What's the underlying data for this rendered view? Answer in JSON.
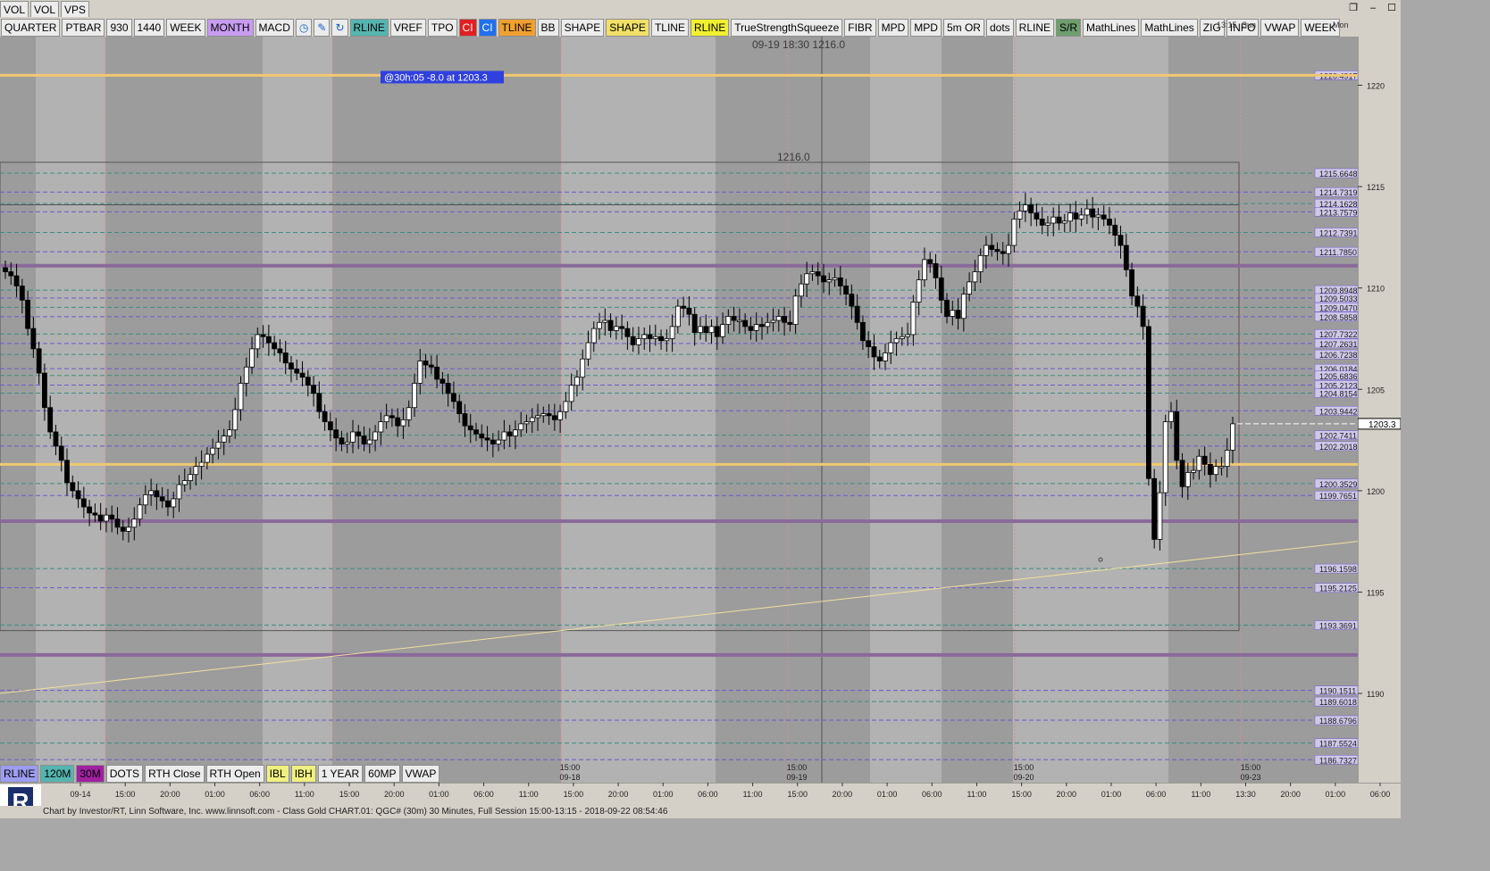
{
  "toolbar_top": {
    "items": [
      {
        "label": "VOL",
        "bg": "#ececec"
      },
      {
        "label": "VOL",
        "bg": "#ececec"
      },
      {
        "label": "VPS",
        "bg": "#ececec"
      }
    ]
  },
  "toolbar_main": {
    "items": [
      {
        "label": "QUARTER",
        "bg": "#ececec",
        "fg": "#000000"
      },
      {
        "label": "PTBAR",
        "bg": "#ececec",
        "fg": "#000000"
      },
      {
        "label": "930",
        "bg": "#ececec",
        "fg": "#000000"
      },
      {
        "label": "1440",
        "bg": "#ececec",
        "fg": "#000000"
      },
      {
        "label": "WEEK",
        "bg": "#ececec",
        "fg": "#000000"
      },
      {
        "label": "MONTH",
        "bg": "#c89cf0",
        "fg": "#000000"
      },
      {
        "label": "MACD",
        "bg": "#ececec",
        "fg": "#000000"
      },
      {
        "icon": "clock-icon",
        "bg": "#ececec"
      },
      {
        "icon": "pencil-icon",
        "bg": "#ececec"
      },
      {
        "icon": "refresh-icon",
        "bg": "#ececec"
      },
      {
        "label": "RLINE",
        "bg": "#56b4b0",
        "fg": "#000000"
      },
      {
        "label": "VREF",
        "bg": "#ececec",
        "fg": "#000000"
      },
      {
        "label": "TPO",
        "bg": "#ececec",
        "fg": "#000000"
      },
      {
        "label": "CI",
        "bg": "#e02020",
        "fg": "#ffffff"
      },
      {
        "label": "CI",
        "bg": "#2070f0",
        "fg": "#ffffff"
      },
      {
        "label": "TLINE",
        "bg": "#f0a030",
        "fg": "#000000"
      },
      {
        "label": "BB",
        "bg": "#ececec",
        "fg": "#000000"
      },
      {
        "label": "SHAPE",
        "bg": "#ececec",
        "fg": "#000000"
      },
      {
        "label": "SHAPE",
        "bg": "#f0e068",
        "fg": "#000000"
      },
      {
        "label": "TLINE",
        "bg": "#ececec",
        "fg": "#000000"
      },
      {
        "label": "RLINE",
        "bg": "#f0f030",
        "fg": "#000000"
      },
      {
        "label": "TrueStrengthSqueeze",
        "bg": "#ececec",
        "fg": "#000000"
      },
      {
        "label": "FIBR",
        "bg": "#ececec",
        "fg": "#000000"
      },
      {
        "label": "MPD",
        "bg": "#ececec",
        "fg": "#000000"
      },
      {
        "label": "MPD",
        "bg": "#ececec",
        "fg": "#000000"
      },
      {
        "label": "5m OR",
        "bg": "#ececec",
        "fg": "#000000"
      },
      {
        "label": "dots",
        "bg": "#ececec",
        "fg": "#000000"
      },
      {
        "label": "RLINE",
        "bg": "#ececec",
        "fg": "#000000"
      },
      {
        "label": "S/R",
        "bg": "#6e9e6e",
        "fg": "#000000"
      },
      {
        "label": "MathLines",
        "bg": "#ececec",
        "fg": "#000000"
      },
      {
        "label": "MathLines",
        "bg": "#ececec",
        "fg": "#000000"
      },
      {
        "label": "ZIG",
        "bg": "#ececec",
        "fg": "#000000"
      },
      {
        "label": "INFO",
        "bg": "#ececec",
        "fg": "#000000"
      },
      {
        "label": "VWAP",
        "bg": "#ececec",
        "fg": "#000000"
      },
      {
        "label": "WEEK",
        "bg": "#ececec",
        "fg": "#000000"
      }
    ]
  },
  "toolbar_bottom": {
    "items": [
      {
        "label": "RLINE",
        "bg": "#9c9cf0",
        "fg": "#000000"
      },
      {
        "label": "120M",
        "bg": "#56b4b0",
        "fg": "#000000"
      },
      {
        "label": "30M",
        "bg": "#a020a0",
        "fg": "#000000"
      },
      {
        "label": "DOTS",
        "bg": "#ececec",
        "fg": "#000000"
      },
      {
        "label": "RTH Close",
        "bg": "#ececec",
        "fg": "#000000"
      },
      {
        "label": "RTH Open",
        "bg": "#ececec",
        "fg": "#000000"
      },
      {
        "label": "IBL",
        "bg": "#f0f080",
        "fg": "#000000"
      },
      {
        "label": "IBH",
        "bg": "#f0f080",
        "fg": "#000000"
      },
      {
        "label": "1 YEAR",
        "bg": "#ececec",
        "fg": "#000000"
      },
      {
        "label": "60MP",
        "bg": "#ececec",
        "fg": "#000000"
      },
      {
        "label": "VWAP",
        "bg": "#ececec",
        "fg": "#000000"
      }
    ]
  },
  "header_labels": {
    "time_top": "13:15",
    "day_top": "Sun",
    "mon_top": "Mon",
    "cursor_readout": "09-19  18:30  1216.0",
    "annotation_box": "@30h:05  -8.0 at 1203.3",
    "level_label": "1216.0"
  },
  "footer": {
    "text": "Chart by Investor/RT, Linn Software, Inc. www.linnsoft.com - Class Gold CHART.01: QGC# (30m) 30 Minutes, Full Session 15:00-13:15 - 2018-09-22 08:54:46"
  },
  "chart_data": {
    "type": "candlestick",
    "symbol": "QGC#",
    "interval": "30 Minutes",
    "ylim": [
      1185.6,
      1222.4
    ],
    "y_ticks": [
      1220,
      1215,
      1210,
      1205,
      1200,
      1195,
      1190
    ],
    "last_price_label": "1203.3",
    "last_price": 1203.3,
    "x_tick_labels": [
      "09-14",
      "15:00",
      "20:00",
      "01:00",
      "06:00",
      "11:00",
      "15:00",
      "20:00",
      "01:00",
      "06:00",
      "11:00",
      "15:00",
      "20:00",
      "01:00",
      "06:00",
      "11:00",
      "15:00",
      "20:00",
      "01:00",
      "06:00",
      "11:00",
      "15:00",
      "20:00",
      "01:00",
      "06:00",
      "11:00",
      "13:30",
      "20:00",
      "01:00",
      "06:00"
    ],
    "session_markers": [
      {
        "time": "15:00",
        "date": "09-18"
      },
      {
        "time": "15:00",
        "date": "09-19"
      },
      {
        "time": "15:00",
        "date": "09-20"
      },
      {
        "time": "15:00",
        "date": "09-23"
      }
    ],
    "levels": [
      {
        "label": "1220.4917",
        "value": 1220.4917
      },
      {
        "label": "1215.6648",
        "value": 1215.6648
      },
      {
        "label": "1214.7319",
        "value": 1214.7319
      },
      {
        "label": "1214.1628",
        "value": 1214.1628
      },
      {
        "label": "1213.7579",
        "value": 1213.7579
      },
      {
        "label": "1212.7391",
        "value": 1212.7391
      },
      {
        "label": "1211.7850",
        "value": 1211.785
      },
      {
        "label": "1209.8948",
        "value": 1209.8948
      },
      {
        "label": "1209.5033",
        "value": 1209.5033
      },
      {
        "label": "1209.0470",
        "value": 1209.047
      },
      {
        "label": "1208.5858",
        "value": 1208.5858
      },
      {
        "label": "1207.7322",
        "value": 1207.7322
      },
      {
        "label": "1207.2631",
        "value": 1207.2631
      },
      {
        "label": "1206.7238",
        "value": 1206.7238
      },
      {
        "label": "1206.0184",
        "value": 1206.0184
      },
      {
        "label": "1205.6836",
        "value": 1205.6836
      },
      {
        "label": "1205.2123",
        "value": 1205.2123
      },
      {
        "label": "1204.8154",
        "value": 1204.8154
      },
      {
        "label": "1203.9442",
        "value": 1203.9442
      },
      {
        "label": "1202.7411",
        "value": 1202.7411
      },
      {
        "label": "1202.2018",
        "value": 1202.2018
      },
      {
        "label": "1200.3529",
        "value": 1200.3529
      },
      {
        "label": "1199.7651",
        "value": 1199.7651
      },
      {
        "label": "1196.1598",
        "value": 1196.1598
      },
      {
        "label": "1195.2125",
        "value": 1195.2125
      },
      {
        "label": "1193.3691",
        "value": 1193.3691
      },
      {
        "label": "1190.1511",
        "value": 1190.1511
      },
      {
        "label": "1189.6018",
        "value": 1189.6018
      },
      {
        "label": "1188.6796",
        "value": 1188.6796
      },
      {
        "label": "1187.5524",
        "value": 1187.5524
      },
      {
        "label": "1186.7327",
        "value": 1186.7327
      }
    ],
    "bands": {
      "yellow": [
        1220.4917,
        1201.3
      ],
      "purple": [
        1211.1,
        1198.5,
        1191.9
      ]
    },
    "series": [
      {
        "name": "close",
        "values": [
          1210.8,
          1210.6,
          1210.1,
          1209.4,
          1208.0,
          1207.0,
          1205.8,
          1204.1,
          1202.9,
          1202.2,
          1201.5,
          1200.4,
          1200.0,
          1199.6,
          1199.2,
          1198.9,
          1198.8,
          1198.5,
          1198.8,
          1198.6,
          1198.2,
          1198.0,
          1198.2,
          1198.6,
          1199.3,
          1199.8,
          1200.0,
          1199.7,
          1199.5,
          1199.2,
          1199.6,
          1200.3,
          1200.5,
          1200.8,
          1201.2,
          1201.4,
          1201.8,
          1202.1,
          1202.4,
          1202.7,
          1203.0,
          1204.0,
          1205.3,
          1206.1,
          1207.0,
          1207.7,
          1207.6,
          1207.3,
          1207.0,
          1206.8,
          1206.3,
          1206.0,
          1205.8,
          1205.6,
          1205.2,
          1204.8,
          1203.9,
          1203.4,
          1203.0,
          1202.6,
          1202.3,
          1202.4,
          1202.9,
          1202.7,
          1202.3,
          1202.5,
          1202.9,
          1203.4,
          1203.7,
          1203.6,
          1203.2,
          1203.5,
          1204.1,
          1205.3,
          1206.4,
          1206.2,
          1206.1,
          1205.5,
          1205.3,
          1204.8,
          1204.4,
          1203.8,
          1203.2,
          1203.0,
          1202.8,
          1202.6,
          1202.5,
          1202.3,
          1202.5,
          1202.9,
          1202.7,
          1203.0,
          1203.3,
          1203.4,
          1203.6,
          1203.7,
          1203.8,
          1203.7,
          1203.5,
          1203.9,
          1204.4,
          1205.2,
          1205.6,
          1206.5,
          1207.3,
          1208.0,
          1208.3,
          1208.4,
          1207.9,
          1208.1,
          1208.0,
          1207.6,
          1207.2,
          1207.5,
          1207.7,
          1207.5,
          1207.6,
          1207.4,
          1207.5,
          1208.1,
          1209.1,
          1209.0,
          1208.7,
          1207.8,
          1208.1,
          1207.8,
          1208.1,
          1207.6,
          1208.2,
          1208.6,
          1208.4,
          1208.4,
          1208.1,
          1207.9,
          1208.2,
          1208.1,
          1208.3,
          1208.4,
          1208.6,
          1208.3,
          1208.2,
          1209.6,
          1210.2,
          1210.7,
          1210.8,
          1210.6,
          1210.3,
          1210.4,
          1210.5,
          1210.1,
          1209.7,
          1209.1,
          1208.3,
          1207.4,
          1207.1,
          1206.6,
          1206.4,
          1206.8,
          1207.3,
          1207.5,
          1207.6,
          1207.7,
          1209.3,
          1210.4,
          1211.4,
          1211.2,
          1210.5,
          1209.4,
          1208.6,
          1208.9,
          1208.5,
          1209.7,
          1210.3,
          1210.8,
          1211.6,
          1212.1,
          1211.9,
          1211.8,
          1211.7,
          1212.1,
          1213.4,
          1213.8,
          1214.1,
          1213.7,
          1213.4,
          1213.1,
          1213.2,
          1213.5,
          1213.2,
          1213.3,
          1213.7,
          1213.4,
          1213.6,
          1213.9,
          1213.5,
          1213.6,
          1213.4,
          1213.1,
          1212.6,
          1212.1,
          1210.9,
          1209.6,
          1209.1,
          1208.1,
          1200.6,
          1197.6,
          1199.9,
          1203.4,
          1203.9,
          1201.5,
          1200.2,
          1200.9,
          1201.0,
          1201.7,
          1201.3,
          1200.8,
          1201.2,
          1201.2,
          1202.0,
          1203.3
        ]
      }
    ]
  }
}
